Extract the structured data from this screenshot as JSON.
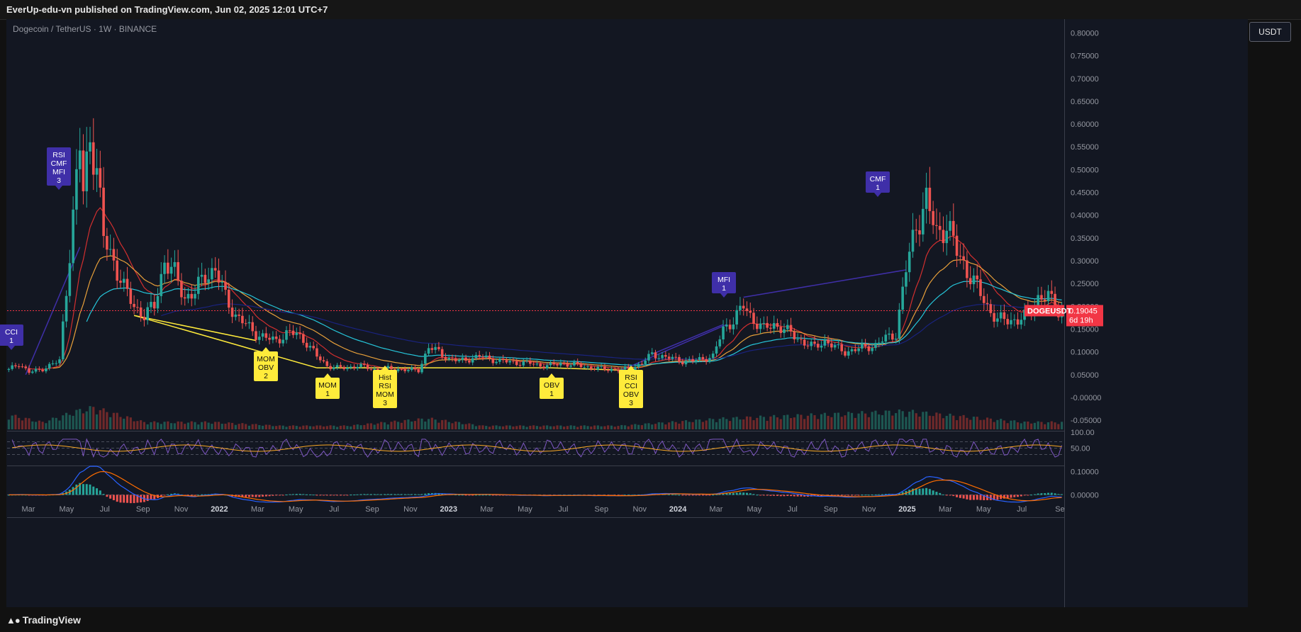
{
  "header": {
    "published": "EverUp-edu-vn published on TradingView.com, Jun 02, 2025 12:01 UTC+7"
  },
  "symbol": {
    "title": "Dogecoin / TetherUS · 1W · BINANCE",
    "ticker": "DOGEUSDT",
    "last_price": "0.19045",
    "countdown": "6d 19h",
    "currency": "USDT"
  },
  "footer": {
    "brand": "TradingView",
    "logo_icon": "tradingview-logo-icon"
  },
  "colors": {
    "background": "#131722",
    "up": "#26a69a",
    "down": "#ef5350",
    "ema_short": "#d32f2f",
    "ema_mid": "#e8a03a",
    "ema_long": "#26c6da",
    "ema_200": "#1a237e",
    "divergence_bull": "#ffeb3b",
    "divergence_bear": "#3f2fa8",
    "price_tag": "#f23645",
    "rsi_line": "#7e57c2",
    "rsi_signal": "#f9a825"
  },
  "chart_data": [
    {
      "type": "candlestick",
      "title": "Dogecoin / TetherUS · 1W · BINANCE",
      "ylim": [
        -0.07,
        0.81
      ],
      "y_ticks": [
        "0.80000",
        "0.75000",
        "0.70000",
        "0.65000",
        "0.60000",
        "0.55000",
        "0.50000",
        "0.45000",
        "0.40000",
        "0.35000",
        "0.30000",
        "0.25000",
        "0.20000",
        "0.15000",
        "0.10000",
        "0.05000",
        "-0.00000",
        "-0.05000"
      ],
      "x_ticks": [
        "Mar",
        "May",
        "Jul",
        "Sep",
        "Nov",
        "2022",
        "Mar",
        "May",
        "Jul",
        "Sep",
        "Nov",
        "2023",
        "Mar",
        "May",
        "Jul",
        "Sep",
        "Nov",
        "2024",
        "Mar",
        "May",
        "Jul",
        "Sep",
        "Nov",
        "2025",
        "Mar",
        "May",
        "Jul",
        "Se"
      ],
      "last_price": 0.19045,
      "price_path": [
        [
          0,
          0.06
        ],
        [
          3,
          0.075
        ],
        [
          6,
          0.055
        ],
        [
          9,
          0.06
        ],
        [
          12,
          0.07
        ],
        [
          15,
          0.08
        ],
        [
          18,
          0.32
        ],
        [
          21,
          0.55
        ],
        [
          22,
          0.45
        ],
        [
          24,
          0.58
        ],
        [
          26,
          0.5
        ],
        [
          28,
          0.35
        ],
        [
          31,
          0.3
        ],
        [
          34,
          0.24
        ],
        [
          37,
          0.2
        ],
        [
          40,
          0.18
        ],
        [
          43,
          0.2
        ],
        [
          46,
          0.3
        ],
        [
          49,
          0.27
        ],
        [
          52,
          0.22
        ],
        [
          55,
          0.23
        ],
        [
          58,
          0.27
        ],
        [
          61,
          0.28
        ],
        [
          64,
          0.22
        ],
        [
          67,
          0.18
        ],
        [
          70,
          0.16
        ],
        [
          73,
          0.14
        ],
        [
          76,
          0.13
        ],
        [
          79,
          0.125
        ],
        [
          82,
          0.14
        ],
        [
          85,
          0.14
        ],
        [
          88,
          0.12
        ],
        [
          91,
          0.09
        ],
        [
          94,
          0.07
        ],
        [
          97,
          0.065
        ],
        [
          100,
          0.065
        ],
        [
          103,
          0.07
        ],
        [
          106,
          0.065
        ],
        [
          109,
          0.06
        ],
        [
          112,
          0.063
        ],
        [
          115,
          0.062
        ],
        [
          118,
          0.06
        ],
        [
          121,
          0.06
        ],
        [
          124,
          0.11
        ],
        [
          127,
          0.1
        ],
        [
          130,
          0.085
        ],
        [
          133,
          0.08
        ],
        [
          136,
          0.085
        ],
        [
          139,
          0.09
        ],
        [
          142,
          0.085
        ],
        [
          145,
          0.08
        ],
        [
          148,
          0.078
        ],
        [
          151,
          0.076
        ],
        [
          154,
          0.075
        ],
        [
          157,
          0.07
        ],
        [
          160,
          0.07
        ],
        [
          163,
          0.075
        ],
        [
          166,
          0.072
        ],
        [
          169,
          0.07
        ],
        [
          172,
          0.065
        ],
        [
          175,
          0.063
        ],
        [
          178,
          0.062
        ],
        [
          181,
          0.06
        ],
        [
          184,
          0.065
        ],
        [
          187,
          0.075
        ],
        [
          190,
          0.095
        ],
        [
          193,
          0.09
        ],
        [
          196,
          0.085
        ],
        [
          199,
          0.08
        ],
        [
          202,
          0.08
        ],
        [
          205,
          0.085
        ],
        [
          208,
          0.09
        ],
        [
          211,
          0.15
        ],
        [
          214,
          0.17
        ],
        [
          217,
          0.2
        ],
        [
          220,
          0.17
        ],
        [
          223,
          0.15
        ],
        [
          226,
          0.16
        ],
        [
          229,
          0.15
        ],
        [
          232,
          0.135
        ],
        [
          235,
          0.12
        ],
        [
          238,
          0.11
        ],
        [
          241,
          0.125
        ],
        [
          244,
          0.11
        ],
        [
          247,
          0.1
        ],
        [
          250,
          0.105
        ],
        [
          253,
          0.11
        ],
        [
          256,
          0.115
        ],
        [
          259,
          0.13
        ],
        [
          262,
          0.14
        ],
        [
          265,
          0.28
        ],
        [
          268,
          0.38
        ],
        [
          271,
          0.43
        ],
        [
          274,
          0.36
        ],
        [
          277,
          0.38
        ],
        [
          280,
          0.32
        ],
        [
          283,
          0.28
        ],
        [
          286,
          0.24
        ],
        [
          289,
          0.2
        ],
        [
          292,
          0.17
        ],
        [
          295,
          0.17
        ],
        [
          298,
          0.17
        ],
        [
          301,
          0.18
        ],
        [
          304,
          0.22
        ],
        [
          307,
          0.22
        ],
        [
          310,
          0.19045
        ]
      ],
      "volume": [
        [
          0,
          0.04
        ],
        [
          10,
          0.02
        ],
        [
          20,
          0.05
        ],
        [
          25,
          0.06
        ],
        [
          40,
          0.02
        ],
        [
          60,
          0.02
        ],
        [
          80,
          0.01
        ],
        [
          100,
          0.01
        ],
        [
          124,
          0.03
        ],
        [
          140,
          0.01
        ],
        [
          180,
          0.01
        ],
        [
          211,
          0.03
        ],
        [
          265,
          0.05
        ],
        [
          300,
          0.02
        ],
        [
          310,
          0.02
        ]
      ],
      "emas": [
        "EMA 20",
        "EMA 50",
        "EMA 100",
        "EMA 200"
      ],
      "signals": [
        {
          "kind": "bear",
          "lines": [
            "CCI",
            "1"
          ]
        },
        {
          "kind": "bear",
          "lines": [
            "RSI",
            "CMF",
            "MFI",
            "3"
          ]
        },
        {
          "kind": "bull",
          "lines": [
            "MOM",
            "OBV",
            "2"
          ]
        },
        {
          "kind": "bull",
          "lines": [
            "MOM",
            "1"
          ]
        },
        {
          "kind": "bull",
          "lines": [
            "Hist",
            "RSI",
            "MOM",
            "3"
          ]
        },
        {
          "kind": "bull",
          "lines": [
            "OBV",
            "1"
          ]
        },
        {
          "kind": "bull",
          "lines": [
            "RSI",
            "CCI",
            "OBV",
            "3"
          ]
        },
        {
          "kind": "bear",
          "lines": [
            "MFI",
            "1"
          ]
        },
        {
          "kind": "bear",
          "lines": [
            "CMF",
            "1"
          ]
        }
      ]
    },
    {
      "type": "line",
      "title": "",
      "ylim": [
        0,
        100
      ],
      "y_ticks": [
        "100.00",
        "50.00"
      ],
      "levels": [
        70,
        50,
        30
      ]
    },
    {
      "type": "bar",
      "title": "",
      "y_ticks": [
        "0.10000",
        "0.00000"
      ],
      "ylim": [
        -0.02,
        0.12
      ]
    }
  ]
}
